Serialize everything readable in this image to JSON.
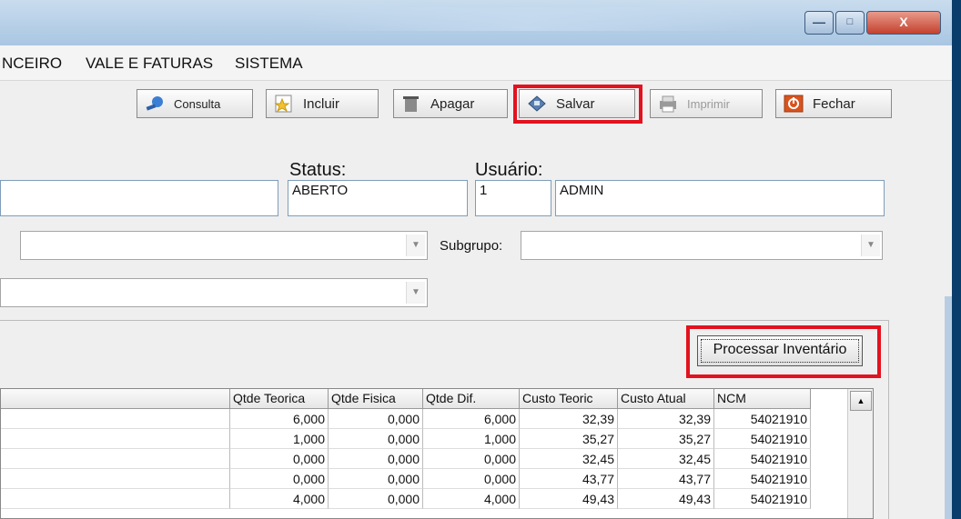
{
  "window": {
    "controls": {
      "minimize": "—",
      "maximize": "□",
      "close": "X"
    }
  },
  "menu": [
    "NCEIRO",
    "VALE E FATURAS",
    "SISTEMA"
  ],
  "toolbar": {
    "consulta": "Consulta",
    "incluir": "Incluir",
    "apagar": "Apagar",
    "salvar": "Salvar",
    "imprimir": "Imprimir",
    "fechar": "Fechar"
  },
  "form": {
    "status_label": "Status:",
    "status_value": "ABERTO",
    "usuario_label": "Usuário:",
    "usuario_id": "1",
    "usuario_nome": "ADMIN",
    "subgrupo_label": "Subgrupo:"
  },
  "process_button": "Processar Inventário",
  "table": {
    "columns": [
      "Qtde Teorica",
      "Qtde Fisica",
      "Qtde Dif.",
      "Custo Teoric",
      "Custo Atual",
      "NCM"
    ],
    "rows": [
      [
        "6,000",
        "0,000",
        "6,000",
        "32,39",
        "32,39",
        "54021910"
      ],
      [
        "1,000",
        "0,000",
        "1,000",
        "35,27",
        "35,27",
        "54021910"
      ],
      [
        "0,000",
        "0,000",
        "0,000",
        "32,45",
        "32,45",
        "54021910"
      ],
      [
        "0,000",
        "0,000",
        "0,000",
        "43,77",
        "43,77",
        "54021910"
      ],
      [
        "4,000",
        "0,000",
        "4,000",
        "49,43",
        "49,43",
        "54021910"
      ]
    ]
  },
  "colors": {
    "highlight": "#e3121f",
    "frame": "#0a3d6b"
  }
}
